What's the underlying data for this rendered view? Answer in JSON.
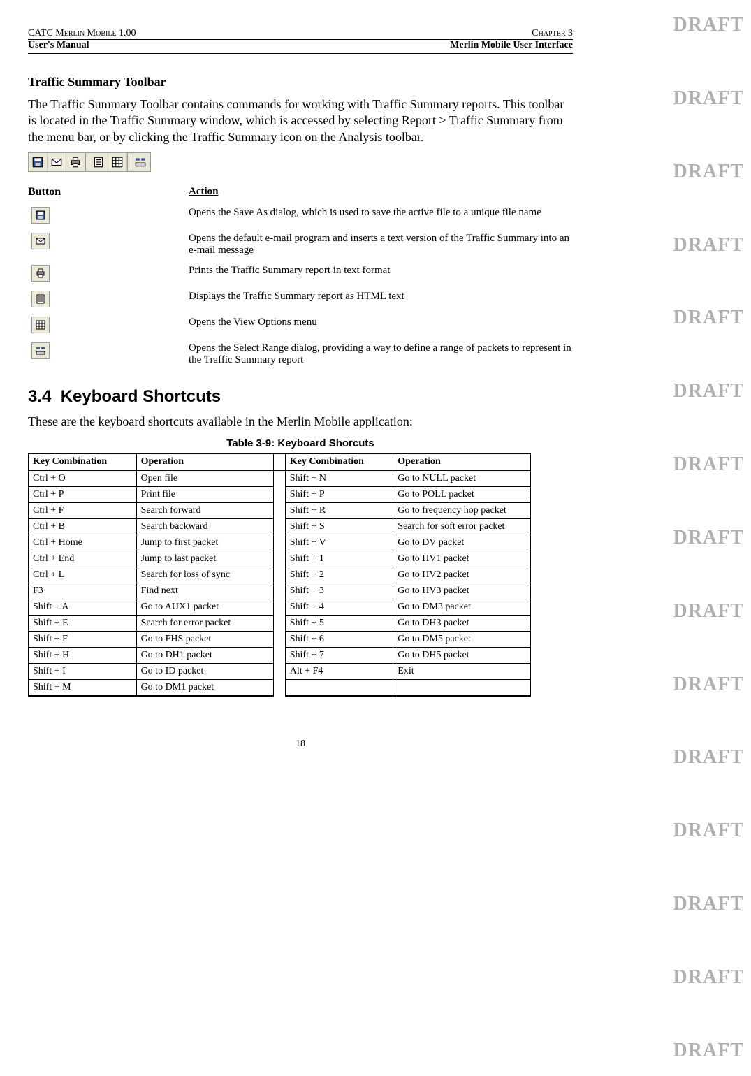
{
  "header": {
    "top_left": "CATC Merlin Mobile 1.00",
    "top_right": "Chapter 3",
    "bottom_left": "User's Manual",
    "bottom_right": "Merlin Mobile User Interface"
  },
  "section1": {
    "title": "Traffic Summary Toolbar",
    "body": "The Traffic Summary Toolbar contains commands for working with Traffic Summary reports.  This toolbar is located in the Traffic Summary window, which is accessed by selecting Report > Traffic Summary from the menu bar, or by clicking the Traffic Summary icon on the Analysis toolbar."
  },
  "button_table": {
    "header_col1": "Button",
    "header_col2": "Action",
    "rows": [
      {
        "action": "Opens the Save As dialog, which is used to save the active file to a unique file name",
        "icon": "save-icon"
      },
      {
        "action": "Opens the default e-mail program and inserts a text version of the Traffic Summary into an e-mail message",
        "icon": "email-icon"
      },
      {
        "action": "Prints the Traffic Summary report in text format",
        "icon": "print-icon"
      },
      {
        "action": "Displays the Traffic Summary report as HTML text",
        "icon": "document-icon"
      },
      {
        "action": "Opens the View Options menu",
        "icon": "grid-icon"
      },
      {
        "action": "Opens the Select Range dialog, providing a way to define a range of packets to represent in the Traffic Summary report",
        "icon": "range-icon"
      }
    ]
  },
  "section2": {
    "number": "3.4",
    "title": "Keyboard Shortcuts",
    "intro": "These are the keyboard shortcuts available in the Merlin Mobile application:",
    "table_caption": "Table 3-9: Keyboard Shorcuts",
    "headers": {
      "key": "Key Combination",
      "op": "Operation"
    },
    "rows": [
      {
        "k1": "Ctrl + O",
        "o1": "Open file",
        "k2": "Shift + N",
        "o2": "Go to NULL packet"
      },
      {
        "k1": "Ctrl + P",
        "o1": "Print file",
        "k2": "Shift + P",
        "o2": "Go to POLL packet"
      },
      {
        "k1": "Ctrl + F",
        "o1": "Search forward",
        "k2": "Shift + R",
        "o2": "Go to frequency hop packet"
      },
      {
        "k1": "Ctrl + B",
        "o1": "Search backward",
        "k2": "Shift + S",
        "o2": "Search for soft error packet"
      },
      {
        "k1": "Ctrl + Home",
        "o1": "Jump to first packet",
        "k2": "Shift + V",
        "o2": "Go to DV packet"
      },
      {
        "k1": "Ctrl + End",
        "o1": "Jump to last packet",
        "k2": "Shift + 1",
        "o2": "Go to HV1 packet"
      },
      {
        "k1": "Ctrl + L",
        "o1": "Search for loss of sync",
        "k2": "Shift + 2",
        "o2": "Go to HV2 packet"
      },
      {
        "k1": "F3",
        "o1": "Find next",
        "k2": "Shift + 3",
        "o2": "Go to HV3 packet"
      },
      {
        "k1": "Shift + A",
        "o1": "Go to AUX1 packet",
        "k2": "Shift + 4",
        "o2": "Go to DM3 packet"
      },
      {
        "k1": "Shift + E",
        "o1": "Search for error packet",
        "k2": "Shift + 5",
        "o2": "Go to DH3 packet"
      },
      {
        "k1": "Shift + F",
        "o1": "Go to FHS packet",
        "k2": "Shift + 6",
        "o2": "Go to DM5 packet"
      },
      {
        "k1": "Shift + H",
        "o1": "Go to DH1 packet",
        "k2": "Shift + 7",
        "o2": "Go to DH5 packet"
      },
      {
        "k1": "Shift + I",
        "o1": "Go to ID packet",
        "k2": "Alt + F4",
        "o2": "Exit"
      },
      {
        "k1": "Shift + M",
        "o1": "Go to DM1 packet",
        "k2": "",
        "o2": ""
      }
    ]
  },
  "page_number": "18",
  "watermark": "DRAFT"
}
